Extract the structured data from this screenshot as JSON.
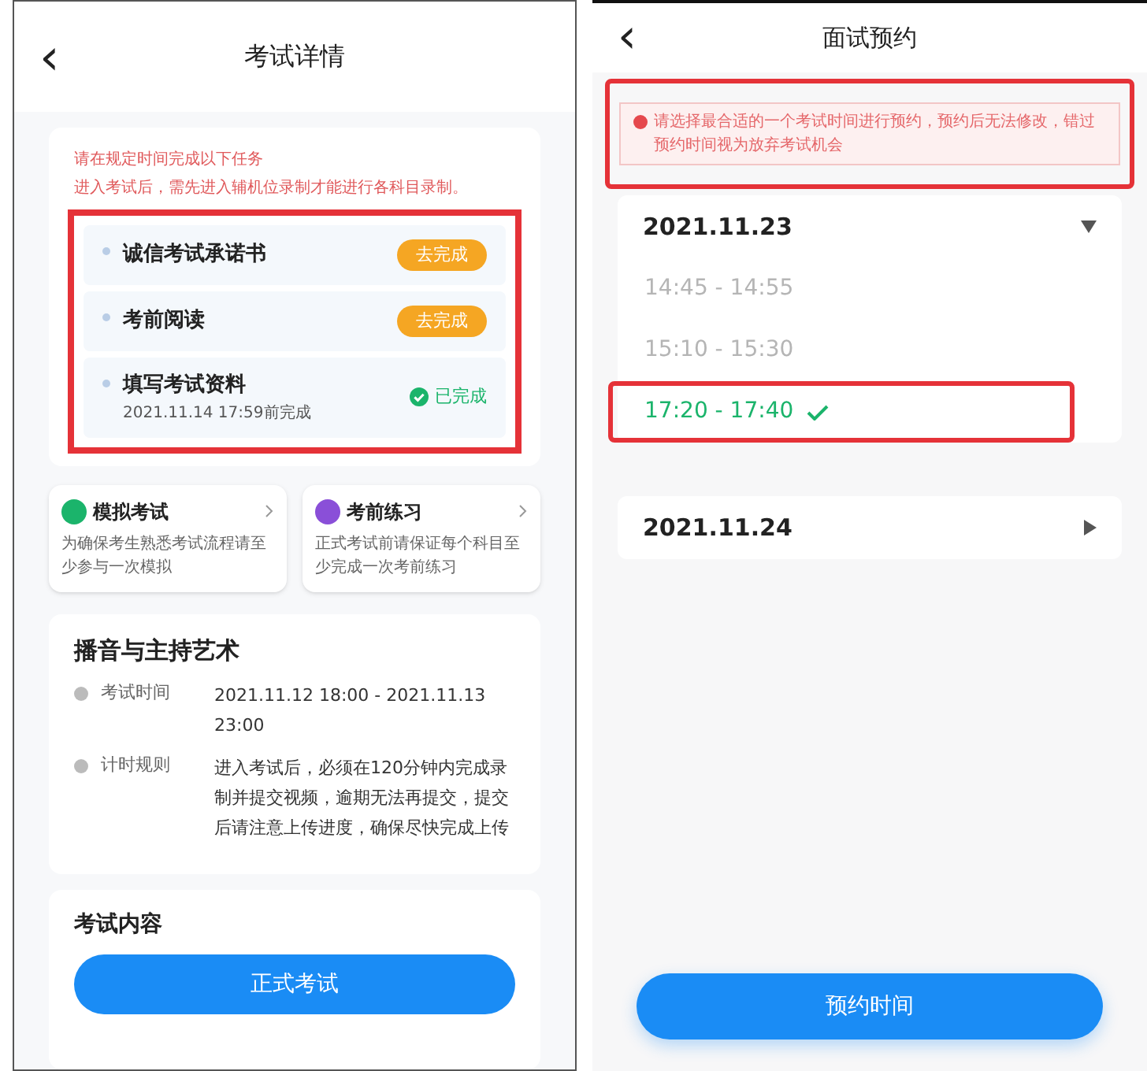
{
  "exam_detail": {
    "back": "‹",
    "title": "考试详情",
    "notice": [
      "请在规定时间完成以下任务",
      "进入考试后，需先进入辅机位录制才能进行各科目录制。"
    ],
    "tasks_highlighted": true,
    "tasks": [
      {
        "kind": "todo",
        "title": "诚信考试承诺书",
        "action": "去完成"
      },
      {
        "kind": "todo",
        "title": "考前阅读",
        "action": "去完成"
      },
      {
        "kind": "done",
        "title": "填写考试资料",
        "deadline": "2021.11.14 17:59前完成",
        "action": "已完成"
      }
    ],
    "shortcuts": [
      {
        "color": "#1bb46b",
        "title": "模拟考试",
        "desc": "为确保考生熟悉考试流程请至少参与一次模拟"
      },
      {
        "color": "#8a4fd8",
        "title": "考前练习",
        "desc": "正式考试前请保证每个科目至少完成一次考前练习"
      }
    ],
    "subject": {
      "title": "播音与主持艺术",
      "rows": [
        {
          "label": "考试时间",
          "value": "2021.11.12 18:00 - 2021.11.13 23:00"
        },
        {
          "label": "计时规则",
          "value": "进入考试后，必须在120分钟内完成录制并提交视频，逾期无法再提交，提交后请注意上传进度，确保尽快完成上传"
        }
      ]
    },
    "content": {
      "title": "考试内容",
      "button": "正式考试"
    }
  },
  "interview": {
    "back": "‹",
    "title": "面试预约",
    "alert": "请选择最合适的一个考试时间进行预约，预约后无法修改，错过预约时间视为放弃考试机会",
    "alert_highlighted": true,
    "dates": [
      {
        "date": "2021.11.23",
        "expanded": true,
        "slots": [
          {
            "time": "14:45 - 14:55",
            "selected": false,
            "highlighted": false
          },
          {
            "time": "15:10 - 15:30",
            "selected": false,
            "highlighted": false
          },
          {
            "time": "17:20 - 17:40",
            "selected": true,
            "highlighted": true
          }
        ]
      },
      {
        "date": "2021.11.24",
        "expanded": false
      }
    ],
    "button": "预约时间"
  }
}
